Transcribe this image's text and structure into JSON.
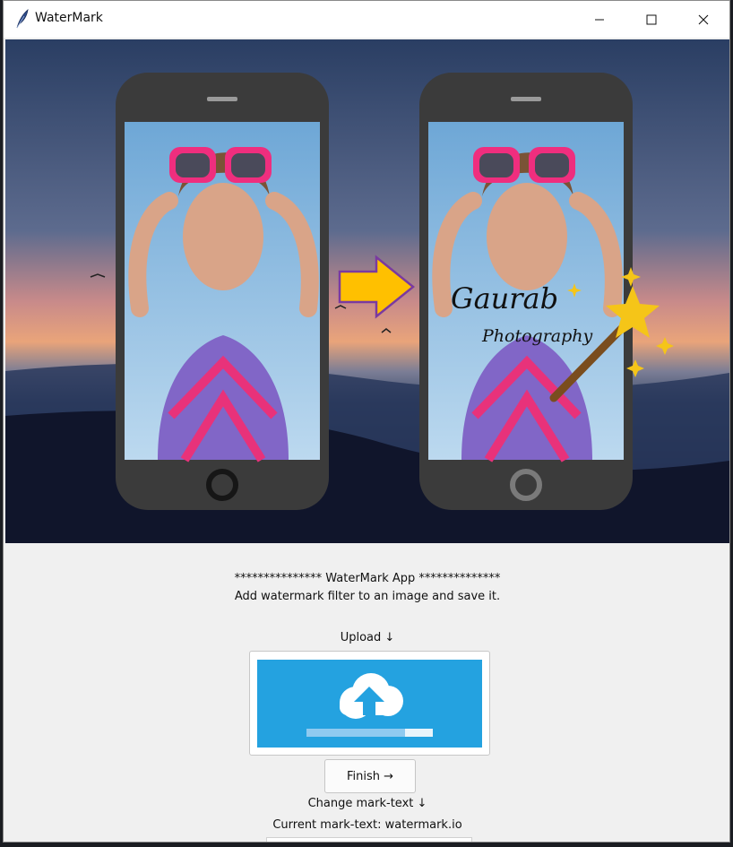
{
  "window": {
    "title": "WaterMark",
    "app_icon": "feather-icon",
    "controls": [
      "minimize-icon",
      "maximize-icon",
      "close-icon"
    ]
  },
  "banner": {
    "description_icons": [
      "phone-original",
      "arrow-right-icon",
      "phone-watermarked",
      "magic-wand-icon"
    ],
    "watermark_line1": "Gaurab",
    "watermark_line2": "Photography"
  },
  "intro": {
    "heading": "*************** WaterMark App **************",
    "subheading": "Add watermark filter to an image and save it."
  },
  "upload": {
    "label": "Upload ↓",
    "icon": "cloud-upload-icon",
    "progress": 0.78
  },
  "finish": {
    "label": "Finish →"
  },
  "mark_text": {
    "change_label": "Change mark-text ↓",
    "current_label": "Current mark-text: watermark.io"
  },
  "colors": {
    "upload_tile": "#24a2e0",
    "arrow": "#ffc000",
    "wand_star": "#f5c518"
  }
}
